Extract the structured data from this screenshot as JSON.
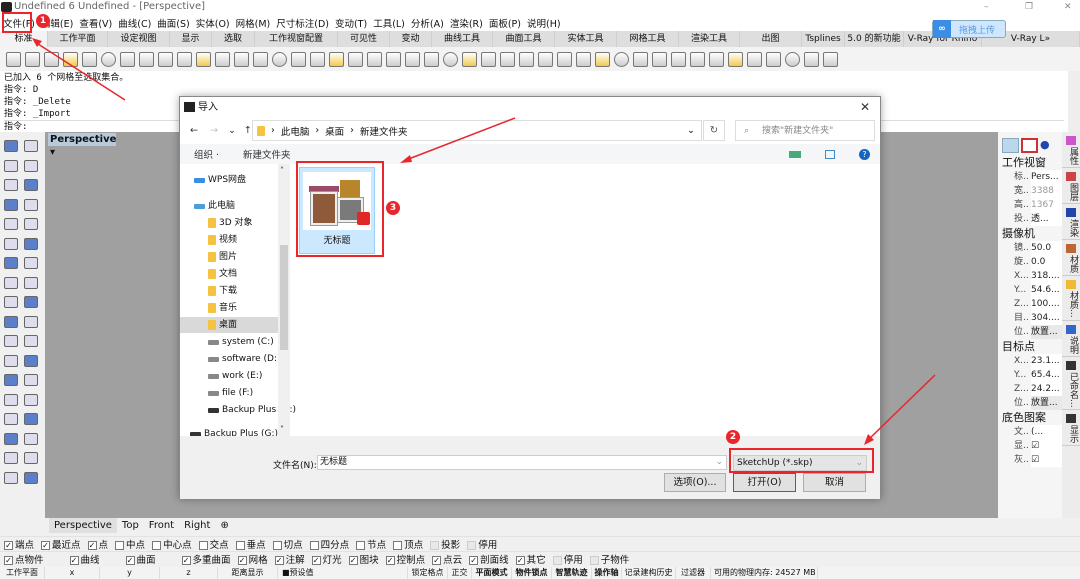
{
  "window": {
    "title": "Undefined 6 Undefined - [Perspective]",
    "controls": [
      "–",
      "❐",
      "✕"
    ]
  },
  "menu": [
    "文件(F)",
    "编辑(E)",
    "查看(V)",
    "曲线(C)",
    "曲面(S)",
    "实体(O)",
    "网格(M)",
    "尺寸标注(D)",
    "变动(T)",
    "工具(L)",
    "分析(A)",
    "渲染(R)",
    "面板(P)",
    "说明(H)"
  ],
  "tabs": [
    "标准",
    "工作平面",
    "设定视图",
    "显示",
    "选取",
    "工作视窗配置",
    "可见性",
    "变动",
    "曲线工具",
    "曲面工具",
    "实体工具",
    "网格工具",
    "渲染工具",
    "出图",
    "Tsplines",
    "5.0 的新功能",
    "V-Ray for Rhino",
    "V-Ray L»"
  ],
  "upload": {
    "label": "拖拽上传"
  },
  "command": {
    "lines": [
      "已加入 6 个网格至选取集合。",
      "指令: D",
      "指令: _Delete",
      "指令: _Import",
      "指令:"
    ]
  },
  "viewport": {
    "label": "Perspective",
    "tabs": [
      "Perspective",
      "Top",
      "Front",
      "Right"
    ]
  },
  "properties": {
    "sections": [
      {
        "title": "工作视窗",
        "rows": [
          [
            "标..",
            "Pers..."
          ],
          [
            "宽..",
            "3388"
          ],
          [
            "高..",
            "1367"
          ],
          [
            "投..",
            "透..."
          ]
        ]
      },
      {
        "title": "摄像机",
        "rows": [
          [
            "镜..",
            "50.0"
          ],
          [
            "旋..",
            "0.0"
          ],
          [
            "X...",
            "318...."
          ],
          [
            "Y...",
            "54.6..."
          ],
          [
            "Z...",
            "100...."
          ],
          [
            "目..",
            "304...."
          ],
          [
            "位..",
            "放置..."
          ]
        ]
      },
      {
        "title": "目标点",
        "rows": [
          [
            "X...",
            "23.1..."
          ],
          [
            "Y...",
            "65.4..."
          ],
          [
            "Z...",
            "24.2..."
          ],
          [
            "位..",
            "放置..."
          ]
        ]
      },
      {
        "title": "底色图案",
        "rows": [
          [
            "文..",
            "(..."
          ],
          [
            "显..",
            "☑"
          ],
          [
            "灰..",
            "☑"
          ]
        ]
      }
    ]
  },
  "side_tabs": [
    "属性",
    "图层",
    "渲染",
    "材质",
    "材质...",
    "说明",
    "已命名...",
    "显示"
  ],
  "osnap": {
    "row1": [
      [
        "端点",
        true
      ],
      [
        "最近点",
        true
      ],
      [
        "点",
        true
      ],
      [
        "中点",
        false
      ],
      [
        "中心点",
        false
      ],
      [
        "交点",
        false
      ],
      [
        "垂点",
        false
      ],
      [
        "切点",
        false
      ],
      [
        "四分点",
        false
      ],
      [
        "节点",
        false
      ],
      [
        "顶点",
        false
      ],
      [
        "投影",
        null
      ],
      [
        "停用",
        null
      ]
    ],
    "row2": [
      [
        "点物件",
        true
      ],
      [
        "曲线",
        true
      ],
      [
        "曲面",
        true
      ],
      [
        "多重曲面",
        true
      ],
      [
        "网格",
        true
      ],
      [
        "注解",
        true
      ],
      [
        "灯光",
        true
      ],
      [
        "图块",
        true
      ],
      [
        "控制点",
        true
      ],
      [
        "点云",
        true
      ],
      [
        "剖面线",
        true
      ],
      [
        "其它",
        true
      ],
      [
        "停用",
        null
      ],
      [
        "子物件",
        null
      ]
    ]
  },
  "status": {
    "cells": [
      "工作平面",
      "x",
      "y",
      "z",
      "距离显示",
      "■预设值",
      "锁定格点",
      "正交",
      "平面模式",
      "物件锁点",
      "智慧轨迹",
      "操作轴",
      "记录建构历史",
      "过滤器",
      "可用的物理内存: 24527 MB"
    ]
  },
  "dialog": {
    "title": "导入",
    "breadcrumb": [
      "此电脑",
      "桌面",
      "新建文件夹"
    ],
    "search_placeholder": "搜索\"新建文件夹\"",
    "toolbar": {
      "organize": "组织 ·",
      "new_folder": "新建文件夹"
    },
    "nav": [
      "WPS网盘",
      "此电脑",
      "3D 对象",
      "视频",
      "图片",
      "文档",
      "下载",
      "音乐",
      "桌面",
      "system (C:)",
      "software (D:)",
      "work (E:)",
      "file (F:)",
      "Backup Plus (G:)",
      "Backup Plus (G:)"
    ],
    "file": {
      "name": "无标题"
    },
    "filename_label": "文件名(N):",
    "filename_value": "无标题",
    "filetype": "SketchUp (*.skp)",
    "buttons": {
      "options": "选项(O)...",
      "open": "打开(O)",
      "cancel": "取消"
    }
  },
  "annotations": [
    "1",
    "2",
    "3"
  ],
  "colors": {
    "annotation": "#e8262b",
    "viewport": "#a0a0a0",
    "selection": "#cce8ff"
  }
}
